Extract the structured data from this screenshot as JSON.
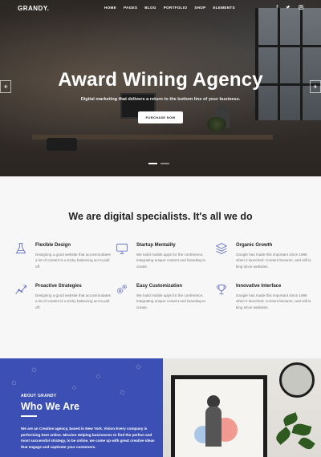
{
  "brand": {
    "logo": "GRANDY."
  },
  "nav": {
    "items": [
      "HOME",
      "PAGES",
      "BLOG",
      "PORTFOLIO",
      "SHOP",
      "ELEMENTS"
    ]
  },
  "social": {
    "items": [
      "f",
      "t",
      "in"
    ]
  },
  "hero": {
    "title": "Award Wining Agency",
    "subtitle": "Digital marketing that delivers a return to the bottom line of your business.",
    "button": "PURCHASE NOW",
    "prev_icon": "chevron-left-icon",
    "next_icon": "chevron-right-icon"
  },
  "services": {
    "heading": "We are digital specialists. It's all we do",
    "features": [
      {
        "icon": "flask-icon",
        "title": "Flexible Design",
        "desc": "Designing a good website that accommodates a lot of content is a tricky balancing act to pull off."
      },
      {
        "icon": "monitor-icon",
        "title": "Startup Mentality",
        "desc": "We build mobile apps for the conference, integrating unique content and branding to create."
      },
      {
        "icon": "layers-icon",
        "title": "Organic Growth",
        "desc": "Google has made this important since 1998 when it launched. Content became, and still is king since websites."
      },
      {
        "icon": "chart-line-icon",
        "title": "Proactive Strategies",
        "desc": "Designing a good website that accommodates a lot of content is a tricky balancing act to pull off."
      },
      {
        "icon": "gears-icon",
        "title": "Easy Customization",
        "desc": "We build mobile apps for the conference, integrating unique content and branding to create."
      },
      {
        "icon": "trophy-icon",
        "title": "Innovative Interface",
        "desc": "Google has made this important since 1998 when it launched. Content became, and still is king since websites."
      }
    ]
  },
  "about": {
    "label": "ABOUT GRANDY",
    "title": "Who We Are",
    "text": "We are an Creative agency, based in New York. Vision Every company is performing best online. Mission Helping businesses to find the perfect and most successful strategy, to be online. we come up with great creative ideas that engage and captivate your customers."
  },
  "colors": {
    "accent": "#3b4fb4",
    "icon": "#6a78c4",
    "hero_overlay": "#2b2724"
  }
}
